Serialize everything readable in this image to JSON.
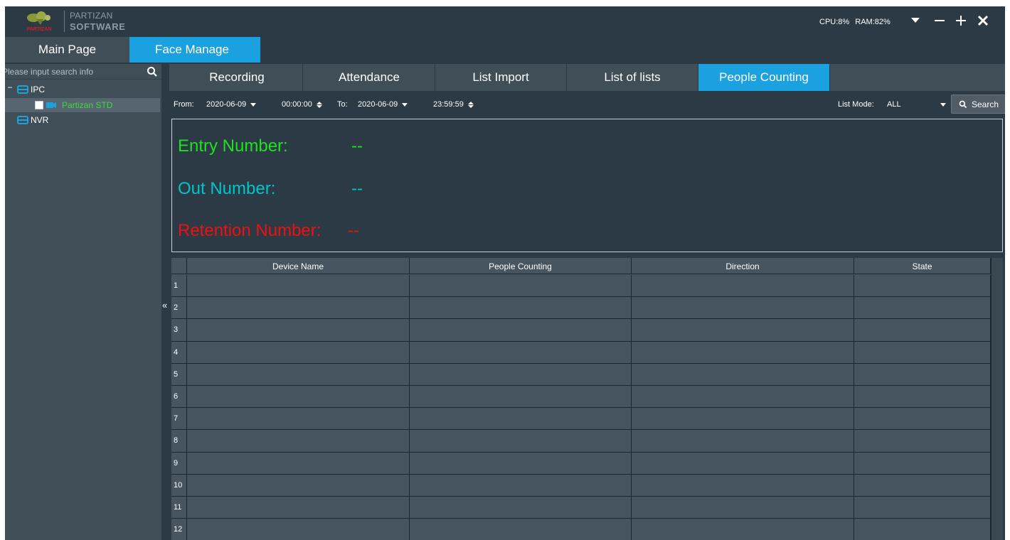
{
  "app": {
    "brand_line1": "PARTIZAN",
    "brand_line2": "SOFTWARE",
    "logo_text": "PARTIZAN",
    "cpu": "CPU:8%",
    "ram": "RAM:82%",
    "controls": {
      "menu": "menu-caret",
      "minimize": "—",
      "maximize": "+",
      "close": "✕"
    }
  },
  "main_tabs": [
    {
      "label": "Main Page",
      "active": false
    },
    {
      "label": "Face Manage",
      "active": true
    }
  ],
  "sidebar": {
    "search_placeholder": "Please input search info",
    "tree": {
      "ipc": {
        "label": "IPC",
        "expanded": true,
        "collapse_symbol": "−"
      },
      "partizan_std": {
        "label": "Partizan STD",
        "checked": false
      },
      "nvr": {
        "label": "NVR"
      }
    },
    "collapse_arrow": "«"
  },
  "sub_tabs": [
    {
      "label": "Recording",
      "active": false
    },
    {
      "label": "Attendance",
      "active": false
    },
    {
      "label": "List Import",
      "active": false
    },
    {
      "label": "List of lists",
      "active": false
    },
    {
      "label": "People Counting",
      "active": true
    }
  ],
  "filter": {
    "from_label": "From:",
    "from_date": "2020-06-09",
    "from_time": "00:00:00",
    "to_label": "To:",
    "to_date": "2020-06-09",
    "to_time": "23:59:59",
    "list_mode_label": "List Mode:",
    "list_mode_value": "ALL",
    "search_label": "Search"
  },
  "stats": {
    "entry_label": "Entry Number:",
    "entry_value": "--",
    "out_label": "Out Number:",
    "out_value": "--",
    "retention_label": "Retention Number:",
    "retention_value": "--",
    "colors": {
      "entry": "#1fe11f",
      "out": "#00c6cc",
      "retention": "#ee1111"
    }
  },
  "table": {
    "columns": [
      "Device Name",
      "People Counting",
      "Direction",
      "State"
    ],
    "row_numbers": [
      "1",
      "2",
      "3",
      "4",
      "5",
      "6",
      "7",
      "8",
      "9",
      "10",
      "11",
      "12"
    ]
  },
  "colors": {
    "accent": "#1ba0e0",
    "background": "#2b3a44",
    "panel": "#404e58"
  }
}
